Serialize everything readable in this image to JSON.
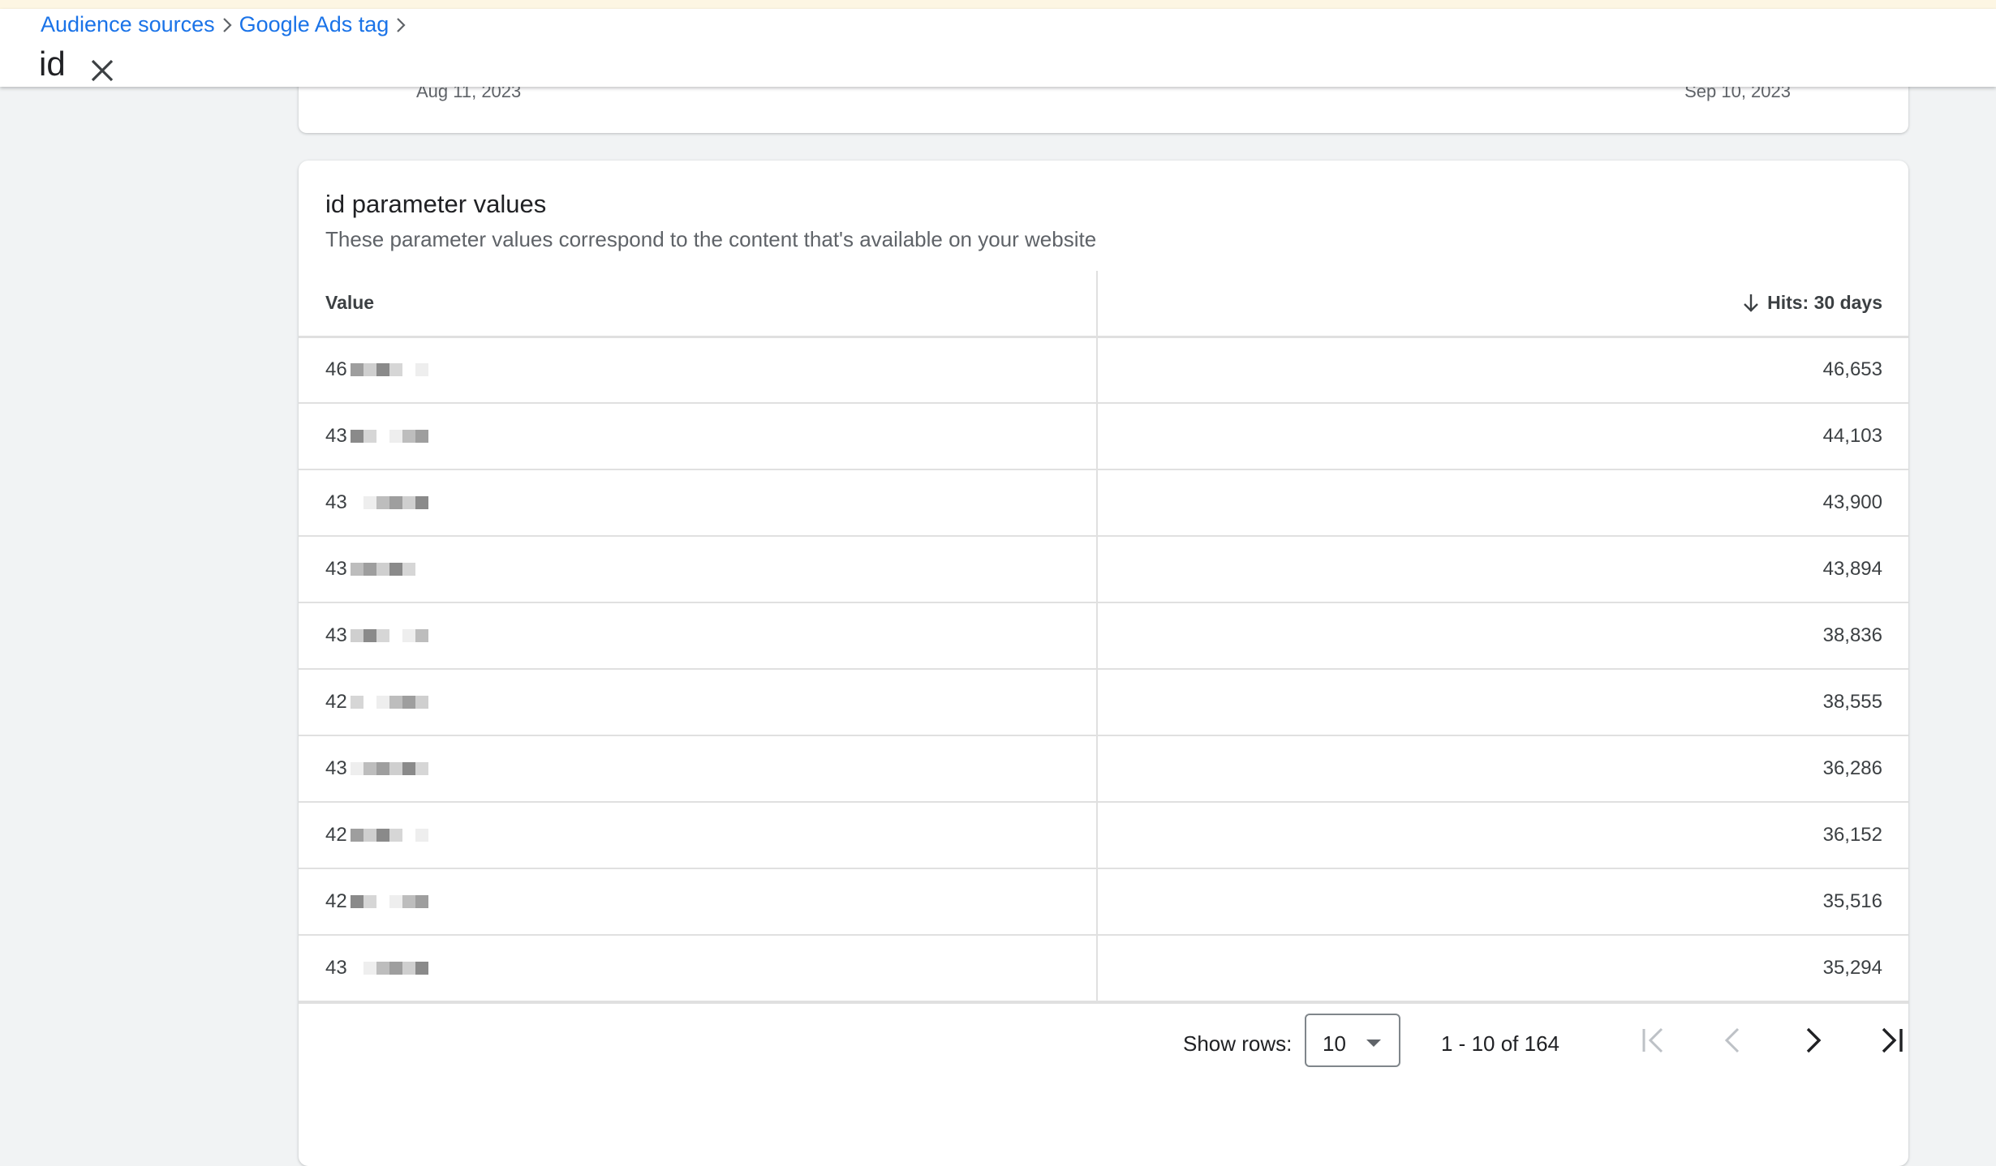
{
  "header": {
    "breadcrumbs": [
      "Audience sources",
      "Google Ads tag"
    ],
    "title": "id"
  },
  "timeline": {
    "start_date": "Aug 11, 2023",
    "end_date": "Sep 10, 2023"
  },
  "card": {
    "title": "id parameter values",
    "subtitle": "These parameter values correspond to the content that's available on your website",
    "columns": {
      "value": "Value",
      "hits": "Hits: 30 days"
    },
    "rows": [
      {
        "value": "46",
        "hits": "46,653"
      },
      {
        "value": "43",
        "hits": "44,103"
      },
      {
        "value": "43",
        "hits": "43,900"
      },
      {
        "value": "43",
        "hits": "43,894"
      },
      {
        "value": "43",
        "hits": "38,836"
      },
      {
        "value": "42",
        "hits": "38,555"
      },
      {
        "value": "43",
        "hits": "36,286"
      },
      {
        "value": "42",
        "hits": "36,152"
      },
      {
        "value": "42",
        "hits": "35,516"
      },
      {
        "value": "43",
        "hits": "35,294"
      }
    ]
  },
  "pager": {
    "show_rows_label": "Show rows:",
    "rows_per_page": "10",
    "range": "1 - 10 of 164"
  },
  "colors": {
    "link": "#1a73e8",
    "text": "#202124",
    "muted": "#5f6368",
    "divider": "#e0e0e0"
  }
}
